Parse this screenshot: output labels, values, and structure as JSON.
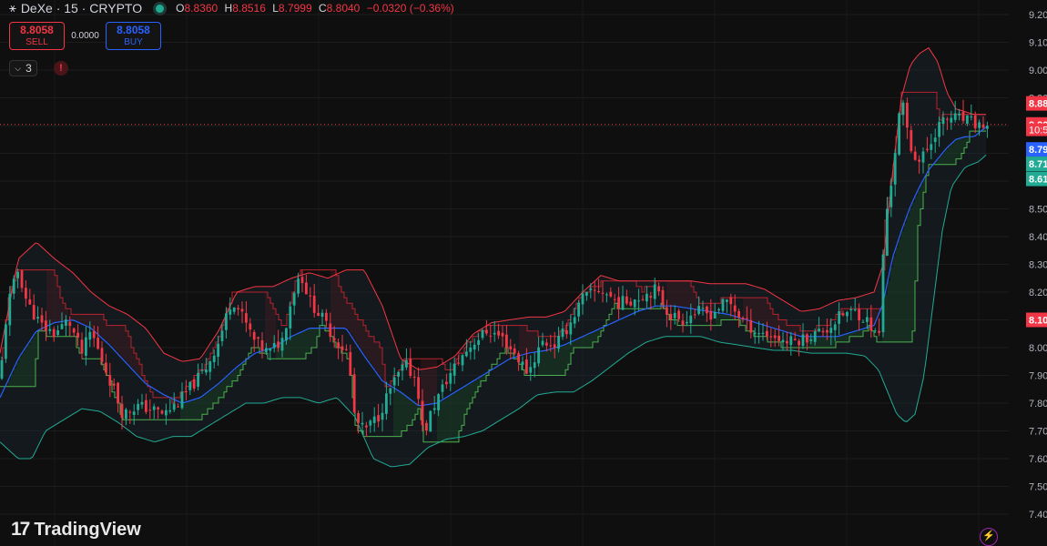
{
  "header": {
    "symbol": "DeXe · 15 · CRYPTO",
    "ohlc": {
      "o_label": "O",
      "o": "8.8360",
      "h_label": "H",
      "h": "8.8516",
      "l_label": "L",
      "l": "8.7999",
      "c_label": "C",
      "c": "8.8040",
      "change": "−0.0320 (−0.36%)"
    }
  },
  "trade": {
    "sell_price": "8.8058",
    "sell_label": "SELL",
    "spread": "0.0000",
    "buy_price": "8.8058",
    "buy_label": "BUY"
  },
  "indicators": {
    "count": "3"
  },
  "branding": {
    "name": "TradingView"
  },
  "colors": {
    "up": "#22ab94",
    "down": "#f23645",
    "upper_band": "#f23645",
    "lower_band": "#22ab94",
    "basis": "#2962ff",
    "background": "#0f0f0f"
  },
  "chart_data": {
    "type": "candlestick",
    "yaxis": {
      "range": [
        7.4,
        9.22
      ],
      "ticks": [
        "9.20",
        "9.10",
        "9.00",
        "8.90",
        "8.80",
        "8.70",
        "8.60",
        "8.50",
        "8.40",
        "8.30",
        "8.20",
        "8.10",
        "8.00",
        "7.90",
        "7.80",
        "7.70",
        "7.60",
        "7.50",
        "7.40"
      ]
    },
    "price_labels": [
      {
        "text": "8.88",
        "value": 8.88,
        "color": "#f23645"
      },
      {
        "text": "8.80",
        "value": 8.804,
        "color": "#f23645"
      },
      {
        "text": "10:5",
        "value": 8.785,
        "color": "#f23645"
      },
      {
        "text": "8.79",
        "value": 8.714,
        "color": "#2962ff"
      },
      {
        "text": "8.71",
        "value": 8.662,
        "color": "#22ab94"
      },
      {
        "text": "8.61",
        "value": 8.608,
        "color": "#22ab94"
      },
      {
        "text": "8.10",
        "value": 8.1,
        "color": "#f23645"
      }
    ],
    "current_price": 8.804,
    "series": [
      {
        "name": "Price",
        "key_points": [
          [
            0,
            7.88
          ],
          [
            8,
            8.15
          ],
          [
            20,
            8.28
          ],
          [
            30,
            8.16
          ],
          [
            45,
            8.08
          ],
          [
            60,
            8.05
          ],
          [
            75,
            8.1
          ],
          [
            90,
            7.98
          ],
          [
            100,
            8.06
          ],
          [
            110,
            7.97
          ],
          [
            125,
            7.85
          ],
          [
            135,
            7.76
          ],
          [
            150,
            7.79
          ],
          [
            165,
            7.78
          ],
          [
            180,
            7.76
          ],
          [
            195,
            7.8
          ],
          [
            210,
            7.86
          ],
          [
            225,
            7.92
          ],
          [
            240,
            8.02
          ],
          [
            255,
            8.18
          ],
          [
            268,
            8.1
          ],
          [
            280,
            8.02
          ],
          [
            295,
            7.98
          ],
          [
            310,
            8.03
          ],
          [
            322,
            8.2
          ],
          [
            330,
            8.27
          ],
          [
            340,
            8.17
          ],
          [
            355,
            8.1
          ],
          [
            370,
            8.02
          ],
          [
            382,
            7.98
          ],
          [
            390,
            7.74
          ],
          [
            400,
            7.7
          ],
          [
            415,
            7.75
          ],
          [
            430,
            7.86
          ],
          [
            445,
            7.94
          ],
          [
            458,
            7.88
          ],
          [
            465,
            7.68
          ],
          [
            475,
            7.78
          ],
          [
            490,
            7.88
          ],
          [
            505,
            7.96
          ],
          [
            520,
            8.02
          ],
          [
            535,
            8.06
          ],
          [
            550,
            8.04
          ],
          [
            565,
            7.98
          ],
          [
            580,
            7.91
          ],
          [
            595,
            8.02
          ],
          [
            610,
            8.01
          ],
          [
            625,
            8.08
          ],
          [
            640,
            8.18
          ],
          [
            660,
            8.21
          ],
          [
            680,
            8.16
          ],
          [
            700,
            8.18
          ],
          [
            720,
            8.21
          ],
          [
            735,
            8.12
          ],
          [
            750,
            8.1
          ],
          [
            765,
            8.13
          ],
          [
            780,
            8.12
          ],
          [
            800,
            8.17
          ],
          [
            815,
            8.1
          ],
          [
            830,
            8.06
          ],
          [
            850,
            8.04
          ],
          [
            865,
            8.02
          ],
          [
            880,
            8.03
          ],
          [
            895,
            8.05
          ],
          [
            910,
            8.07
          ],
          [
            925,
            8.12
          ],
          [
            940,
            8.13
          ],
          [
            955,
            8.09
          ],
          [
            965,
            8.02
          ],
          [
            972,
            8.45
          ],
          [
            980,
            8.62
          ],
          [
            990,
            8.9
          ],
          [
            1000,
            8.72
          ],
          [
            1010,
            8.67
          ],
          [
            1020,
            8.72
          ],
          [
            1030,
            8.8
          ],
          [
            1045,
            8.83
          ],
          [
            1060,
            8.82
          ],
          [
            1075,
            8.8
          ],
          [
            1088,
            8.8
          ]
        ]
      },
      {
        "name": "Upper band",
        "key_points": [
          [
            0,
            7.98
          ],
          [
            20,
            8.32
          ],
          [
            40,
            8.38
          ],
          [
            60,
            8.32
          ],
          [
            80,
            8.27
          ],
          [
            100,
            8.2
          ],
          [
            120,
            8.15
          ],
          [
            140,
            8.12
          ],
          [
            160,
            8.07
          ],
          [
            180,
            7.98
          ],
          [
            200,
            7.95
          ],
          [
            220,
            7.96
          ],
          [
            240,
            8.06
          ],
          [
            260,
            8.2
          ],
          [
            280,
            8.22
          ],
          [
            300,
            8.22
          ],
          [
            320,
            8.25
          ],
          [
            340,
            8.27
          ],
          [
            360,
            8.25
          ],
          [
            380,
            8.28
          ],
          [
            400,
            8.28
          ],
          [
            420,
            8.15
          ],
          [
            440,
            7.96
          ],
          [
            460,
            7.92
          ],
          [
            480,
            7.93
          ],
          [
            500,
            7.97
          ],
          [
            520,
            8.05
          ],
          [
            540,
            8.09
          ],
          [
            560,
            8.1
          ],
          [
            580,
            8.11
          ],
          [
            600,
            8.11
          ],
          [
            620,
            8.13
          ],
          [
            640,
            8.2
          ],
          [
            660,
            8.26
          ],
          [
            680,
            8.24
          ],
          [
            700,
            8.24
          ],
          [
            720,
            8.24
          ],
          [
            740,
            8.24
          ],
          [
            760,
            8.24
          ],
          [
            780,
            8.23
          ],
          [
            800,
            8.23
          ],
          [
            820,
            8.23
          ],
          [
            840,
            8.21
          ],
          [
            860,
            8.17
          ],
          [
            880,
            8.13
          ],
          [
            900,
            8.14
          ],
          [
            920,
            8.17
          ],
          [
            940,
            8.18
          ],
          [
            960,
            8.2
          ],
          [
            970,
            8.3
          ],
          [
            980,
            8.62
          ],
          [
            990,
            8.9
          ],
          [
            1000,
            9.02
          ],
          [
            1010,
            9.06
          ],
          [
            1020,
            9.08
          ],
          [
            1030,
            9.03
          ],
          [
            1040,
            8.92
          ],
          [
            1050,
            8.86
          ],
          [
            1060,
            8.85
          ],
          [
            1070,
            8.84
          ],
          [
            1085,
            8.84
          ]
        ]
      },
      {
        "name": "Basis",
        "key_points": [
          [
            0,
            7.82
          ],
          [
            20,
            7.96
          ],
          [
            40,
            8.06
          ],
          [
            60,
            8.09
          ],
          [
            80,
            8.1
          ],
          [
            100,
            8.07
          ],
          [
            120,
            8.01
          ],
          [
            140,
            7.94
          ],
          [
            160,
            7.87
          ],
          [
            180,
            7.83
          ],
          [
            200,
            7.8
          ],
          [
            220,
            7.82
          ],
          [
            240,
            7.87
          ],
          [
            260,
            7.93
          ],
          [
            280,
            7.98
          ],
          [
            300,
            8.0
          ],
          [
            320,
            8.04
          ],
          [
            340,
            8.07
          ],
          [
            360,
            8.07
          ],
          [
            380,
            8.07
          ],
          [
            400,
            7.97
          ],
          [
            420,
            7.88
          ],
          [
            440,
            7.84
          ],
          [
            460,
            7.79
          ],
          [
            480,
            7.8
          ],
          [
            500,
            7.84
          ],
          [
            520,
            7.88
          ],
          [
            540,
            7.92
          ],
          [
            560,
            7.96
          ],
          [
            580,
            7.98
          ],
          [
            600,
            7.99
          ],
          [
            620,
            8.01
          ],
          [
            640,
            8.04
          ],
          [
            660,
            8.07
          ],
          [
            680,
            8.1
          ],
          [
            700,
            8.13
          ],
          [
            720,
            8.15
          ],
          [
            740,
            8.15
          ],
          [
            760,
            8.14
          ],
          [
            780,
            8.13
          ],
          [
            800,
            8.12
          ],
          [
            820,
            8.1
          ],
          [
            840,
            8.08
          ],
          [
            860,
            8.06
          ],
          [
            880,
            8.04
          ],
          [
            900,
            8.04
          ],
          [
            920,
            8.04
          ],
          [
            940,
            8.06
          ],
          [
            960,
            8.08
          ],
          [
            970,
            8.16
          ],
          [
            980,
            8.32
          ],
          [
            990,
            8.42
          ],
          [
            1000,
            8.51
          ],
          [
            1010,
            8.58
          ],
          [
            1020,
            8.64
          ],
          [
            1030,
            8.68
          ],
          [
            1040,
            8.72
          ],
          [
            1050,
            8.75
          ],
          [
            1060,
            8.76
          ],
          [
            1070,
            8.76
          ],
          [
            1085,
            8.8
          ]
        ]
      },
      {
        "name": "Lower band",
        "key_points": [
          [
            0,
            7.66
          ],
          [
            20,
            7.6
          ],
          [
            35,
            7.6
          ],
          [
            50,
            7.7
          ],
          [
            70,
            7.74
          ],
          [
            90,
            7.78
          ],
          [
            110,
            7.77
          ],
          [
            130,
            7.73
          ],
          [
            150,
            7.68
          ],
          [
            170,
            7.66
          ],
          [
            190,
            7.68
          ],
          [
            210,
            7.68
          ],
          [
            230,
            7.72
          ],
          [
            250,
            7.76
          ],
          [
            270,
            7.8
          ],
          [
            290,
            7.8
          ],
          [
            310,
            7.82
          ],
          [
            330,
            7.82
          ],
          [
            350,
            7.8
          ],
          [
            370,
            7.82
          ],
          [
            390,
            7.75
          ],
          [
            410,
            7.6
          ],
          [
            430,
            7.57
          ],
          [
            450,
            7.58
          ],
          [
            470,
            7.64
          ],
          [
            490,
            7.67
          ],
          [
            510,
            7.68
          ],
          [
            530,
            7.7
          ],
          [
            550,
            7.74
          ],
          [
            570,
            7.78
          ],
          [
            590,
            7.83
          ],
          [
            610,
            7.84
          ],
          [
            630,
            7.84
          ],
          [
            650,
            7.88
          ],
          [
            670,
            7.93
          ],
          [
            690,
            7.98
          ],
          [
            710,
            8.02
          ],
          [
            730,
            8.04
          ],
          [
            750,
            8.04
          ],
          [
            770,
            8.04
          ],
          [
            790,
            8.02
          ],
          [
            810,
            8.01
          ],
          [
            830,
            8.0
          ],
          [
            850,
            7.99
          ],
          [
            870,
            7.99
          ],
          [
            890,
            7.98
          ],
          [
            910,
            7.98
          ],
          [
            930,
            7.98
          ],
          [
            950,
            7.97
          ],
          [
            965,
            7.92
          ],
          [
            975,
            7.84
          ],
          [
            985,
            7.76
          ],
          [
            995,
            7.73
          ],
          [
            1005,
            7.76
          ],
          [
            1015,
            7.9
          ],
          [
            1025,
            8.16
          ],
          [
            1035,
            8.42
          ],
          [
            1045,
            8.58
          ],
          [
            1060,
            8.65
          ],
          [
            1075,
            8.67
          ],
          [
            1085,
            8.7
          ]
        ]
      }
    ]
  }
}
